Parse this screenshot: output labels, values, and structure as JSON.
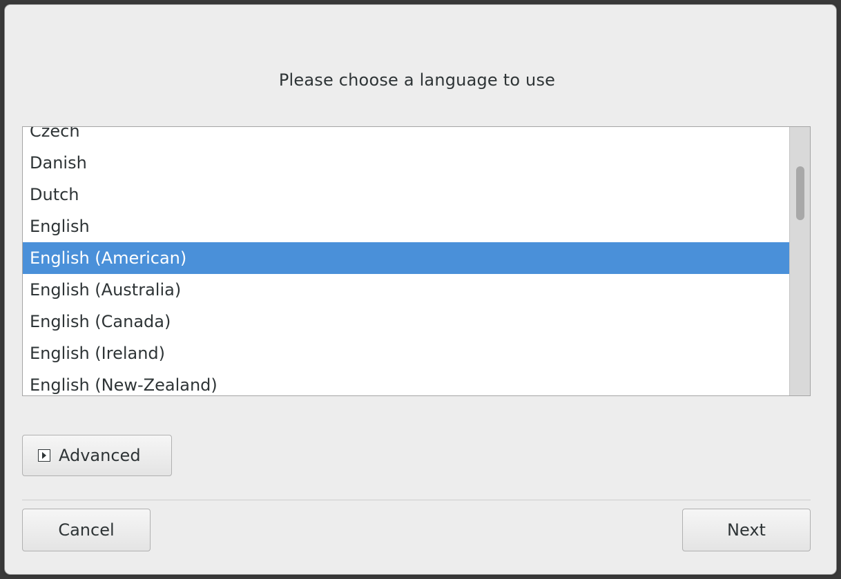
{
  "dialog": {
    "title": "Please choose a language to use"
  },
  "language_list": {
    "items": [
      {
        "label": "Czech",
        "selected": false
      },
      {
        "label": "Danish",
        "selected": false
      },
      {
        "label": "Dutch",
        "selected": false
      },
      {
        "label": "English",
        "selected": false
      },
      {
        "label": "English (American)",
        "selected": true
      },
      {
        "label": "English (Australia)",
        "selected": false
      },
      {
        "label": "English (Canada)",
        "selected": false
      },
      {
        "label": "English (Ireland)",
        "selected": false
      },
      {
        "label": "English (New-Zealand)",
        "selected": false
      }
    ],
    "selection_color": "#4a90d9"
  },
  "advanced": {
    "label": "Advanced",
    "icon": "expander-collapsed-icon"
  },
  "footer": {
    "cancel_label": "Cancel",
    "next_label": "Next"
  }
}
